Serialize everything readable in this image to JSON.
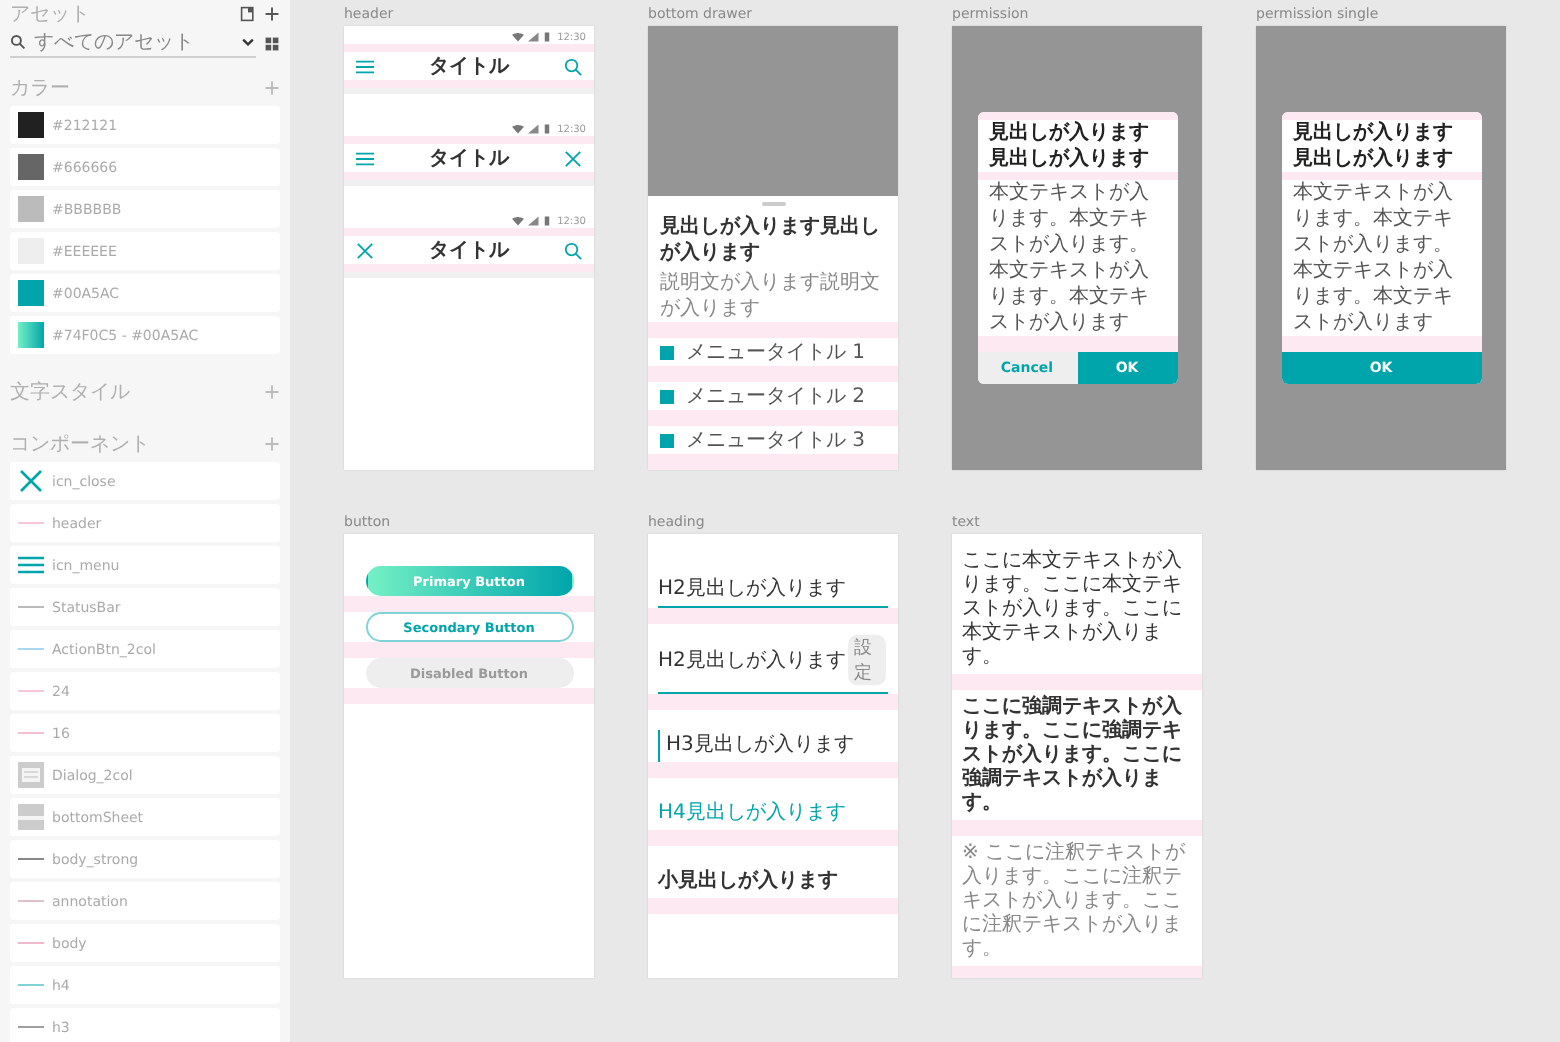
{
  "sidebar": {
    "title": "アセット",
    "search": {
      "value": "すべてのアセット"
    },
    "colors_heading": "カラー",
    "colors": [
      {
        "label": "#212121",
        "kind": "solid",
        "color": "#212121"
      },
      {
        "label": "#666666",
        "kind": "solid",
        "color": "#666666"
      },
      {
        "label": "#BBBBBB",
        "kind": "solid",
        "color": "#bbbbbb"
      },
      {
        "label": "#EEEEEE",
        "kind": "solid",
        "color": "#eeeeee"
      },
      {
        "label": "#00A5AC",
        "kind": "solid",
        "color": "#00a5ac"
      },
      {
        "label": "#74F0C5 - #00A5AC",
        "kind": "gradient"
      }
    ],
    "text_styles_heading": "文字スタイル",
    "components_heading": "コンポーネント",
    "components": [
      {
        "label": "icn_close",
        "kind": "close"
      },
      {
        "label": "header",
        "kind": "line",
        "color": "#f7c6d9"
      },
      {
        "label": "icn_menu",
        "kind": "menu"
      },
      {
        "label": "StatusBar",
        "kind": "line",
        "color": "#bbbbbb"
      },
      {
        "label": "ActionBtn_2col",
        "kind": "line",
        "color": "#a8d8f0"
      },
      {
        "label": "24",
        "kind": "line",
        "color": "#f7c6d9"
      },
      {
        "label": "16",
        "kind": "line",
        "color": "#f2c0d2"
      },
      {
        "label": "Dialog_2col",
        "kind": "dialog"
      },
      {
        "label": "bottomSheet",
        "kind": "sheet"
      },
      {
        "label": "body_strong",
        "kind": "line",
        "color": "#888888"
      },
      {
        "label": "annotation",
        "kind": "line",
        "color": "#e0c0cc"
      },
      {
        "label": "body",
        "kind": "line",
        "color": "#f2b8cc"
      },
      {
        "label": "h4",
        "kind": "line",
        "color": "#7fd3d6"
      },
      {
        "label": "h3",
        "kind": "line",
        "color": "#a0a0a0"
      }
    ]
  },
  "artboards": [
    {
      "label": "header",
      "kind": "header",
      "bars": [
        {
          "time": "12:30",
          "title": "タイトル",
          "left": {
            "kind": "menu"
          },
          "right": {
            "kind": "search"
          }
        },
        {
          "time": "12:30",
          "title": "タイトル",
          "left": {
            "kind": "menu"
          },
          "right": {
            "kind": "close"
          }
        },
        {
          "time": "12:30",
          "title": "タイトル",
          "left": {
            "kind": "close"
          },
          "right": {
            "kind": "search"
          }
        }
      ]
    },
    {
      "label": "bottom drawer",
      "kind": "drawer",
      "heading": "見出しが入ります見出しが入ります",
      "description": "説明文が入ります説明文が入ります",
      "items": [
        "メニュータイトル 1",
        "メニュータイトル 2",
        "メニュータイトル 3"
      ]
    },
    {
      "label": "permission",
      "kind": "dialog",
      "title": "見出しが入ります見出しが入ります",
      "body": "本文テキストが入ります。本文テキストが入ります。本文テキストが入ります。本文テキストが入ります",
      "buttons": [
        {
          "label": "Cancel",
          "kind": "secondary"
        },
        {
          "label": "OK",
          "kind": "primary"
        }
      ]
    },
    {
      "label": "permission single",
      "kind": "dialog",
      "title": "見出しが入ります見出しが入ります",
      "body": "本文テキストが入ります。本文テキストが入ります。本文テキストが入ります。本文テキストが入ります",
      "buttons": [
        {
          "label": "OK",
          "kind": "primary"
        }
      ]
    },
    {
      "label": "button",
      "kind": "buttons",
      "buttons": [
        {
          "label": "Primary Button",
          "kind": "primary"
        },
        {
          "label": "Secondary Button",
          "kind": "secondary"
        },
        {
          "label": "Disabled Button",
          "kind": "disabled"
        }
      ]
    },
    {
      "label": "heading",
      "kind": "headings",
      "items": [
        {
          "kind": "h2",
          "text": "H2見出しが入ります"
        },
        {
          "kind": "h2",
          "text": "H2見出しが入ります",
          "badge": "設定"
        },
        {
          "kind": "h3",
          "text": "H3見出しが入ります"
        },
        {
          "kind": "h4",
          "text": "H4見出しが入ります"
        },
        {
          "kind": "small",
          "text": "小見出しが入ります"
        }
      ]
    },
    {
      "label": "text",
      "kind": "text",
      "paragraphs": [
        {
          "kind": "body",
          "text": "ここに本文テキストが入ります。ここに本文テキストが入ります。ここに本文テキストが入ります。"
        },
        {
          "kind": "strong",
          "text": "ここに強調テキストが入ります。ここに強調テキストが入ります。ここに強調テキストが入ります。"
        },
        {
          "kind": "annotation",
          "text": "※ ここに注釈テキストが入ります。ここに注釈テキストが入ります。ここに注釈テキストが入ります。"
        }
      ]
    }
  ]
}
